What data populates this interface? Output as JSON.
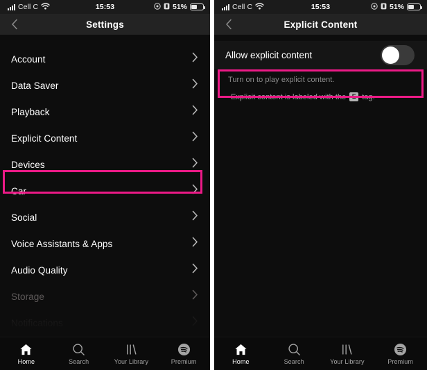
{
  "colors": {
    "highlight": "#ec1a87",
    "screen_bg": "#0d0d0d",
    "navbar_bg": "#232323",
    "text_primary": "#ffffff",
    "text_muted": "#8b8b8b"
  },
  "status_bar": {
    "carrier": "Cell C",
    "signal_icon": "signal-bars-icon",
    "wifi_icon": "wifi-icon",
    "time": "15:53",
    "location_icon": "location-icon",
    "alarm_icon": "alarm-icon",
    "battery_percent": "51%",
    "battery_icon": "battery-icon"
  },
  "left_screen": {
    "nav": {
      "back_icon": "chevron-left-icon",
      "title": "Settings"
    },
    "settings_items": [
      {
        "label": "Account",
        "state": "normal",
        "highlighted": false
      },
      {
        "label": "Data Saver",
        "state": "normal",
        "highlighted": false
      },
      {
        "label": "Playback",
        "state": "normal",
        "highlighted": false
      },
      {
        "label": "Explicit Content",
        "state": "normal",
        "highlighted": true
      },
      {
        "label": "Devices",
        "state": "normal",
        "highlighted": false
      },
      {
        "label": "Car",
        "state": "normal",
        "highlighted": false
      },
      {
        "label": "Social",
        "state": "normal",
        "highlighted": false
      },
      {
        "label": "Voice Assistants & Apps",
        "state": "normal",
        "highlighted": false
      },
      {
        "label": "Audio Quality",
        "state": "normal",
        "highlighted": false
      },
      {
        "label": "Storage",
        "state": "dim",
        "highlighted": false
      },
      {
        "label": "Notifications",
        "state": "dimmer",
        "highlighted": false
      }
    ]
  },
  "right_screen": {
    "nav": {
      "back_icon": "chevron-left-icon",
      "title": "Explicit Content"
    },
    "toggle": {
      "label": "Allow explicit content",
      "state": "off",
      "highlighted": true
    },
    "help_text_1": "Turn on to play explicit content.",
    "help_text_2_before": "Explicit content is labeled with the",
    "help_tag": "E",
    "help_text_2_after": "tag."
  },
  "tab_bar": {
    "tabs": [
      {
        "label": "Home",
        "icon": "home-icon",
        "active": true
      },
      {
        "label": "Search",
        "icon": "search-icon",
        "active": false
      },
      {
        "label": "Your Library",
        "icon": "library-icon",
        "active": false
      },
      {
        "label": "Premium",
        "icon": "spotify-icon",
        "active": false
      }
    ]
  }
}
